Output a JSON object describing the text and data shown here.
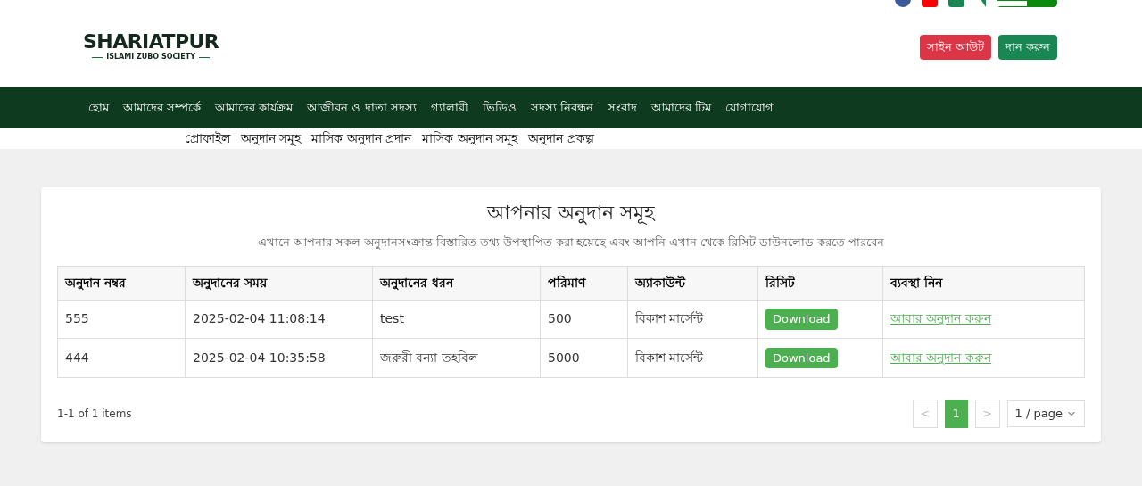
{
  "header": {
    "logo": {
      "title": "SHARIATPUR",
      "subtitle": "ISLAMI ZUBO SOCIETY"
    },
    "buttons": [
      {
        "label": "সাইন আউট",
        "kind": "danger"
      },
      {
        "label": "দান করুন",
        "kind": "primary"
      }
    ]
  },
  "nav": {
    "items": [
      "হোম",
      "আমাদের সম্পর্কে",
      "আমাদের কার্যক্রম",
      "আজীবন ও দাতা সদস্য",
      "গ্যালারী",
      "ভিডিও",
      "সদস্য নিবন্ধন",
      "সংবাদ",
      "আমাদের টিম",
      "যোগাযোগ"
    ]
  },
  "subnav": {
    "items": [
      "প্রোফাইল",
      "অনুদান সমূহ",
      "মাসিক অনুদান প্রদান",
      "মাসিক অনুদান সমূহ",
      "অনুদান প্রকল্প"
    ]
  },
  "card": {
    "title": "আপনার অনুদান সমূহ",
    "description": "এখানে আপনার সকল অনুদানসংক্রান্ত বিস্তারিত তথ্য উপস্থাপিত করা হয়েছে এবং আপনি এখান থেকে রিসিট ডাউনলোড করতে পারবেন"
  },
  "table": {
    "columns": [
      "অনুদান নম্বর",
      "অনুদানের সময়",
      "অনুদানের ধরন",
      "পরিমাণ",
      "অ্যাকাউন্ট",
      "রিসিট",
      "ব্যবস্থা নিন"
    ],
    "rows": [
      {
        "number": "555",
        "time": "2025-02-04 11:08:14",
        "type": "test",
        "amount": "500",
        "account": "বিকাশ মার্সেন্ট",
        "receipt": "Download",
        "action": "আবার অনুদান করুন"
      },
      {
        "number": "444",
        "time": "2025-02-04 10:35:58",
        "type": "জরুরী বন্যা তহবিল",
        "amount": "5000",
        "account": "বিকাশ মার্সেন্ট",
        "receipt": "Download",
        "action": "আবার অনুদান করুন"
      }
    ]
  },
  "pagination": {
    "summary": "1-1 of 1 items",
    "prev": "<",
    "next": ">",
    "pages": [
      {
        "label": "1",
        "selected": true
      }
    ],
    "page_size": "1 / page"
  }
}
